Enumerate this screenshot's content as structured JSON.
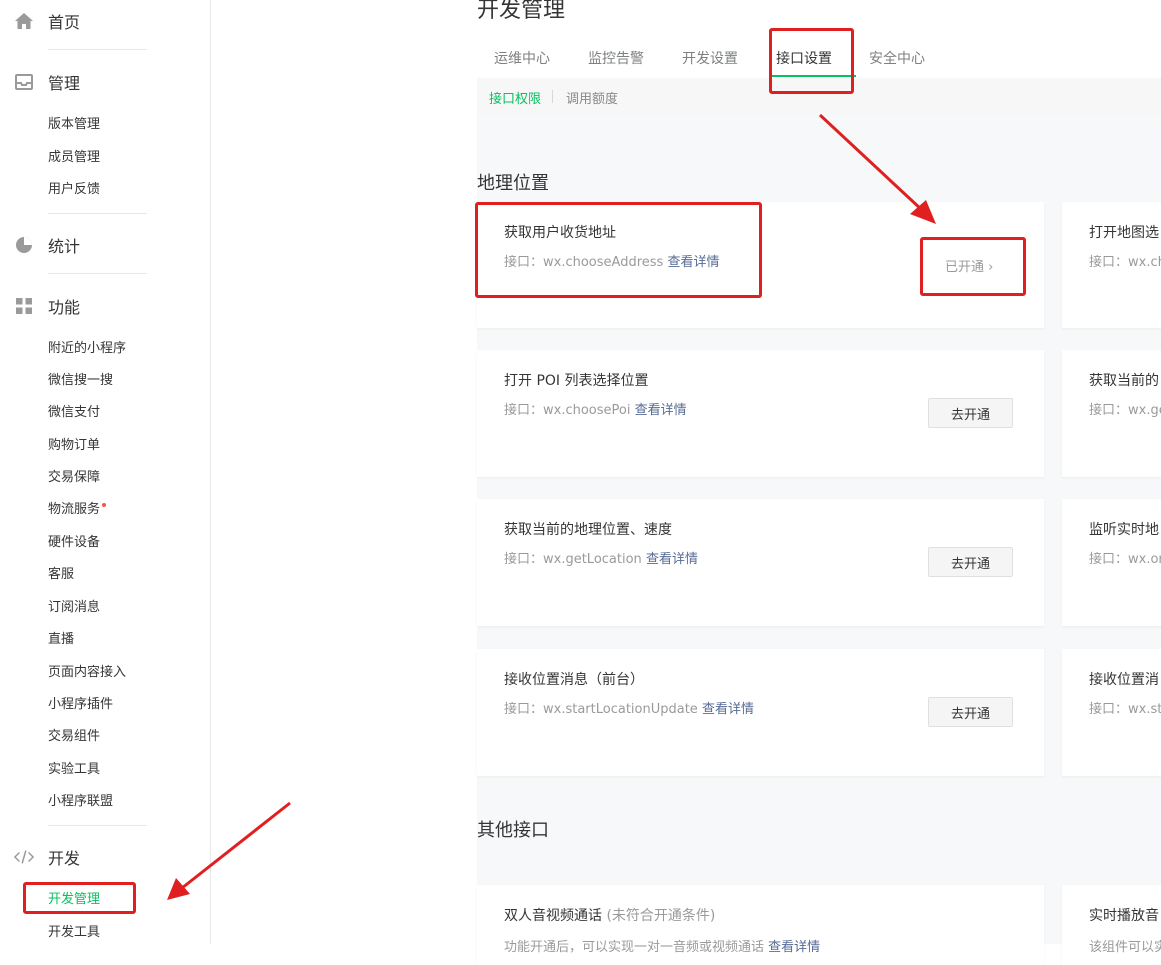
{
  "sidebar": {
    "home": "首页",
    "manage": {
      "label": "管理",
      "items": [
        "版本管理",
        "成员管理",
        "用户反馈"
      ]
    },
    "stats": "统计",
    "features": {
      "label": "功能",
      "items": [
        "附近的小程序",
        "微信搜一搜",
        "微信支付",
        "购物订单",
        "交易保障",
        "物流服务",
        "硬件设备",
        "客服",
        "订阅消息",
        "直播",
        "页面内容接入",
        "小程序插件",
        "交易组件",
        "实验工具",
        "小程序联盟"
      ]
    },
    "dev": {
      "label": "开发",
      "items": [
        "开发管理",
        "开发工具"
      ]
    }
  },
  "page": {
    "title": "开发管理",
    "tabs": [
      "运维中心",
      "监控告警",
      "开发设置",
      "接口设置",
      "安全中心"
    ],
    "subtabs": [
      "接口权限",
      "调用额度"
    ]
  },
  "sections": {
    "geo": {
      "title": "地理位置",
      "cards_left": [
        {
          "title": "获取用户收货地址",
          "api": "接口：wx.chooseAddress",
          "link": "查看详情",
          "status": "已开通 ›"
        },
        {
          "title": "打开 POI 列表选择位置",
          "api": "接口：wx.choosePoi",
          "link": "查看详情",
          "button": "去开通"
        },
        {
          "title": "获取当前的地理位置、速度",
          "api": "接口：wx.getLocation",
          "link": "查看详情",
          "button": "去开通"
        },
        {
          "title": "接收位置消息（前台）",
          "api": "接口：wx.startLocationUpdate",
          "link": "查看详情",
          "button": "去开通"
        }
      ],
      "cards_right": [
        {
          "title": "打开地图选",
          "api": "接口：wx.ch"
        },
        {
          "title": "获取当前的",
          "api": "接口：wx.ge"
        },
        {
          "title": "监听实时地",
          "api": "接口：wx.on"
        },
        {
          "title": "接收位置消",
          "api": "接口：wx.sta"
        }
      ]
    },
    "other": {
      "title": "其他接口",
      "cards_left": [
        {
          "title": "双人音视频通话",
          "note": "(未符合开通条件)",
          "desc": "功能开通后，可以实现一对一音频或视频通话",
          "link": "查看详情"
        }
      ],
      "cards_right": [
        {
          "title": "实时播放音",
          "desc": "该组件可以实"
        }
      ]
    }
  },
  "colors": {
    "accent": "#07c160",
    "link": "#576b95",
    "highlight": "#e02020"
  }
}
